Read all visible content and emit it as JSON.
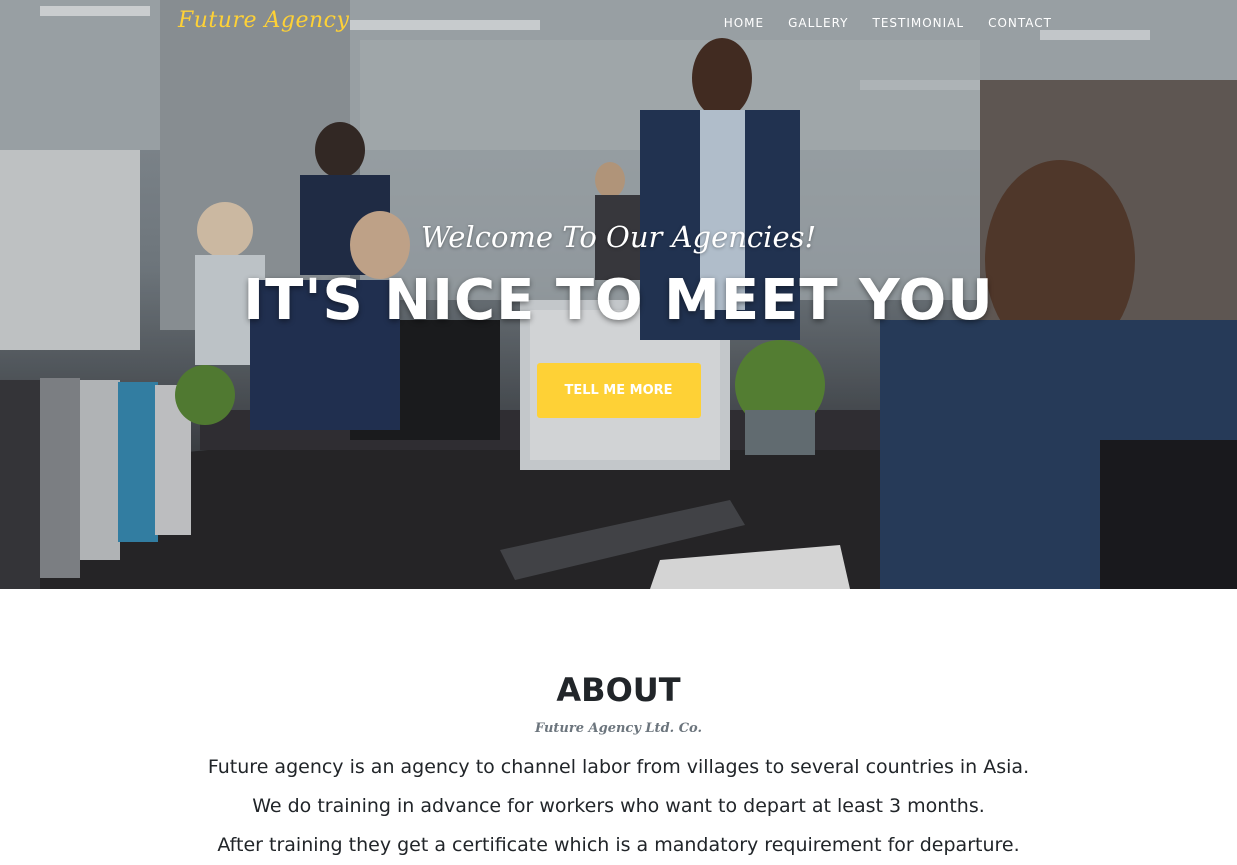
{
  "brand": "Future Agency",
  "nav": {
    "links": [
      "HOME",
      "GALLERY",
      "TESTIMONIAL",
      "CONTACT"
    ]
  },
  "hero": {
    "lead": "Welcome To Our Agencies!",
    "heading": "IT'S NICE TO MEET YOU",
    "button": "TELL ME MORE"
  },
  "about": {
    "title": "ABOUT",
    "subtitle": "Future Agency Ltd. Co.",
    "lines": [
      "Future agency is an agency to channel labor from villages to several countries in Asia.",
      "We do training in advance for workers who want to depart at least 3 months.",
      "After training they get a certificate which is a mandatory requirement for departure."
    ]
  },
  "colors": {
    "accent": "#fed136",
    "text": "#212529",
    "muted": "#6c757d"
  }
}
